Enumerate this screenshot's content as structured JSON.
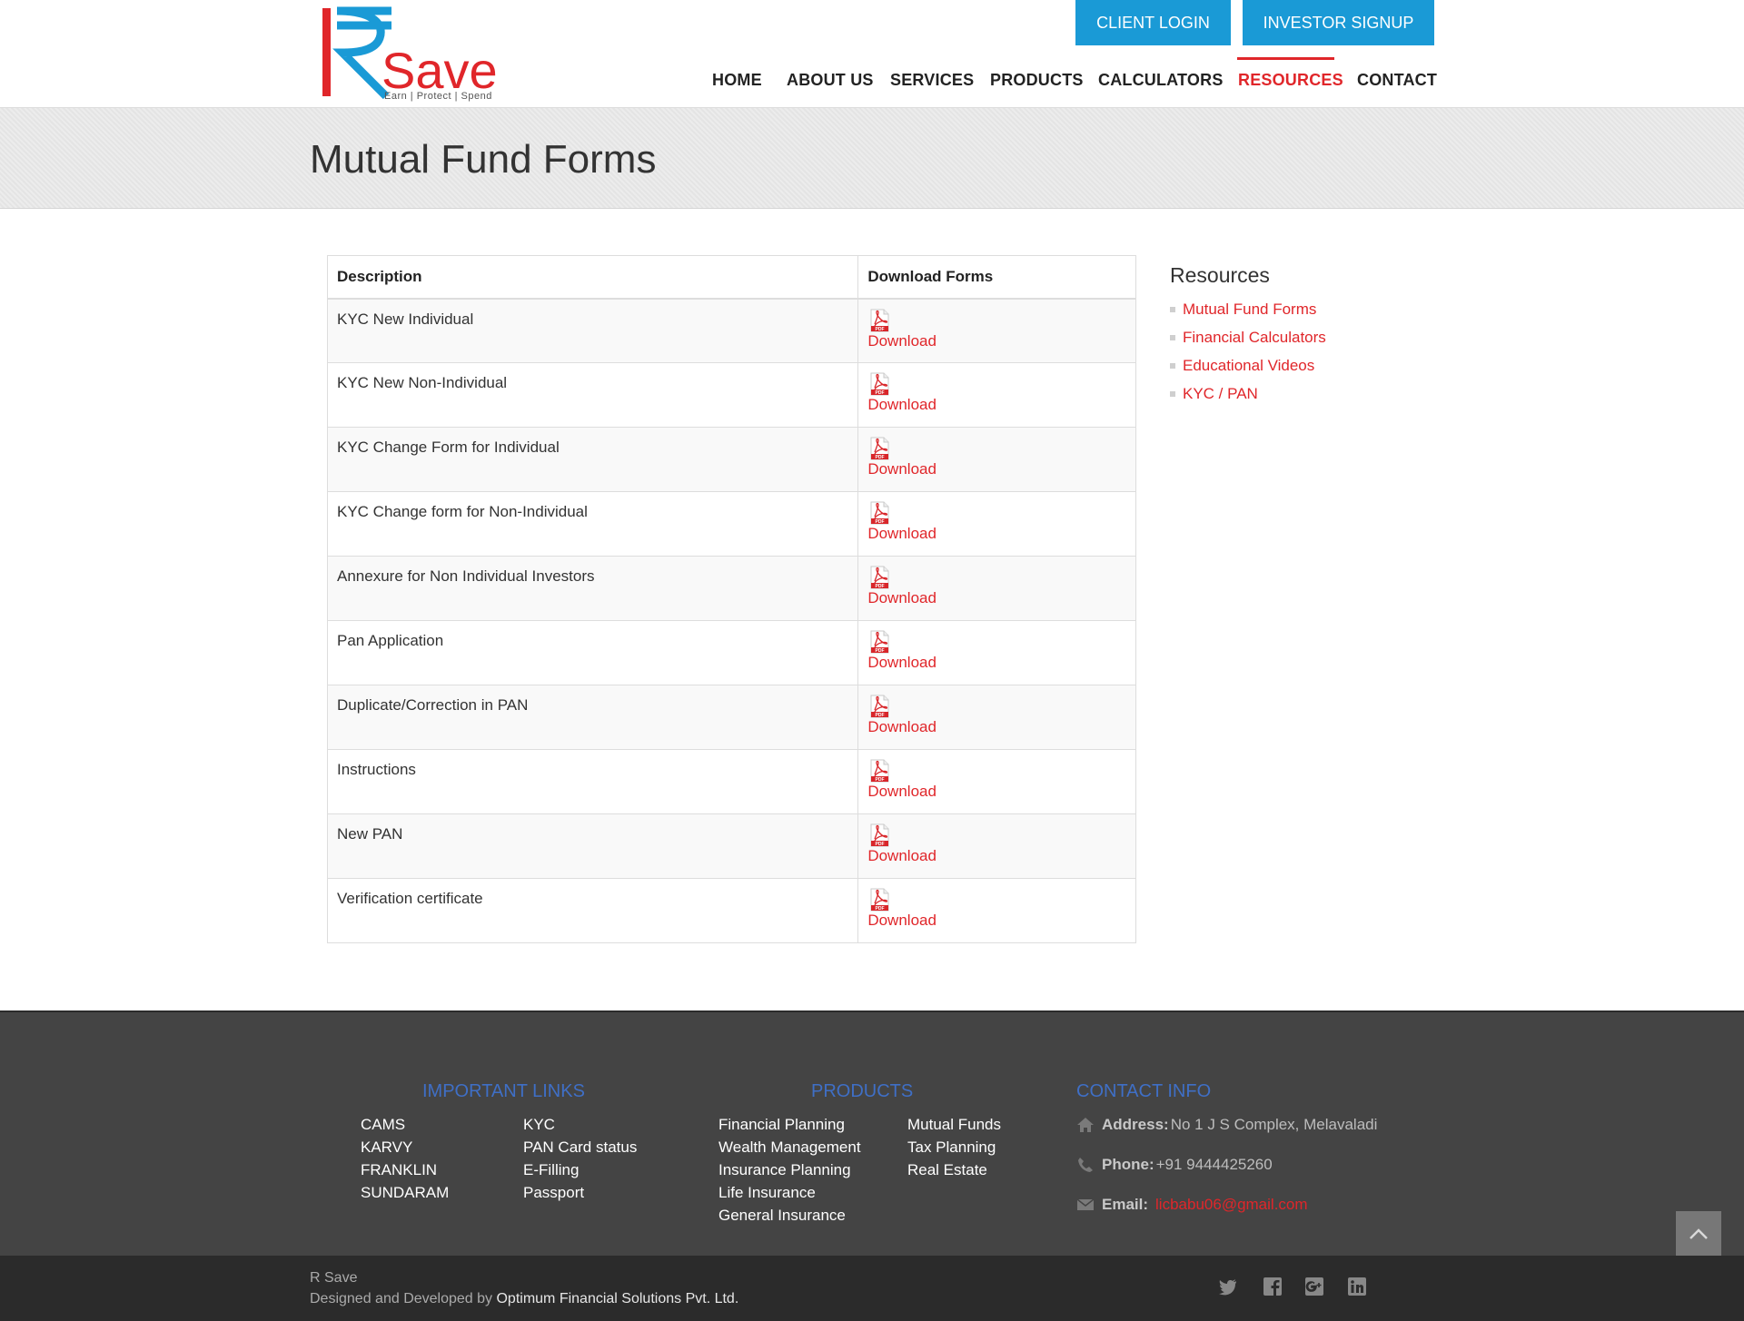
{
  "brand": {
    "name_letter": "R",
    "name_word": "Save",
    "tagline": "Earn | Protect | Spend"
  },
  "header": {
    "client_login": "CLIENT LOGIN",
    "investor_signup": "INVESTOR SIGNUP"
  },
  "nav": {
    "items": [
      {
        "label": "HOME"
      },
      {
        "label": "ABOUT US"
      },
      {
        "label": "SERVICES"
      },
      {
        "label": "PRODUCTS"
      },
      {
        "label": "CALCULATORS"
      },
      {
        "label": "RESOURCES",
        "active": true
      },
      {
        "label": "CONTACT"
      }
    ]
  },
  "page": {
    "title": "Mutual Fund Forms"
  },
  "table": {
    "headers": {
      "description": "Description",
      "download": "Download Forms"
    },
    "download_label": "Download",
    "pdf_icon_label": "PDF",
    "rows": [
      {
        "description": "KYC New Individual"
      },
      {
        "description": "KYC New Non-Individual"
      },
      {
        "description": "KYC Change Form for Individual"
      },
      {
        "description": "KYC Change form for Non-Individual"
      },
      {
        "description": "Annexure for Non Individual Investors"
      },
      {
        "description": "Pan Application"
      },
      {
        "description": "Duplicate/Correction in PAN"
      },
      {
        "description": "Instructions"
      },
      {
        "description": "New PAN"
      },
      {
        "description": "Verification certificate"
      }
    ]
  },
  "sidebar": {
    "title": "Resources",
    "items": [
      {
        "label": "Mutual Fund Forms"
      },
      {
        "label": "Financial Calculators"
      },
      {
        "label": "Educational Videos"
      },
      {
        "label": "KYC / PAN"
      }
    ]
  },
  "footer": {
    "important_links": {
      "heading": "IMPORTANT LINKS",
      "col1": [
        "CAMS",
        "KARVY",
        "FRANKLIN",
        "SUNDARAM"
      ],
      "col2": [
        "KYC",
        "PAN Card status",
        "E-Filling",
        "Passport"
      ]
    },
    "products": {
      "heading": "PRODUCTS",
      "col1": [
        "Financial Planning",
        "Wealth Management",
        "Insurance Planning",
        "Life Insurance",
        "General Insurance"
      ],
      "col2": [
        "Mutual Funds",
        "Tax Planning",
        "Real Estate"
      ]
    },
    "contact": {
      "heading": "CONTACT INFO",
      "address_label": "Address:",
      "address_value": "No 1 J S Complex, Melavaladi",
      "phone_label": "Phone:",
      "phone_value": "+91 9444425260",
      "email_label": "Email:",
      "email_value": "licbabu06@gmail.com"
    },
    "copyright_name": "R Save",
    "designed_by_prefix": "Designed and Developed by ",
    "designed_by_company": "Optimum Financial Solutions Pvt. Ltd."
  },
  "colors": {
    "accent_red": "#e0262a",
    "button_blue": "#1a9ad6",
    "footer_heading_blue": "#3f6fc6",
    "footer_bg": "#444444",
    "bottom_bar_bg": "#2b2b2b"
  }
}
